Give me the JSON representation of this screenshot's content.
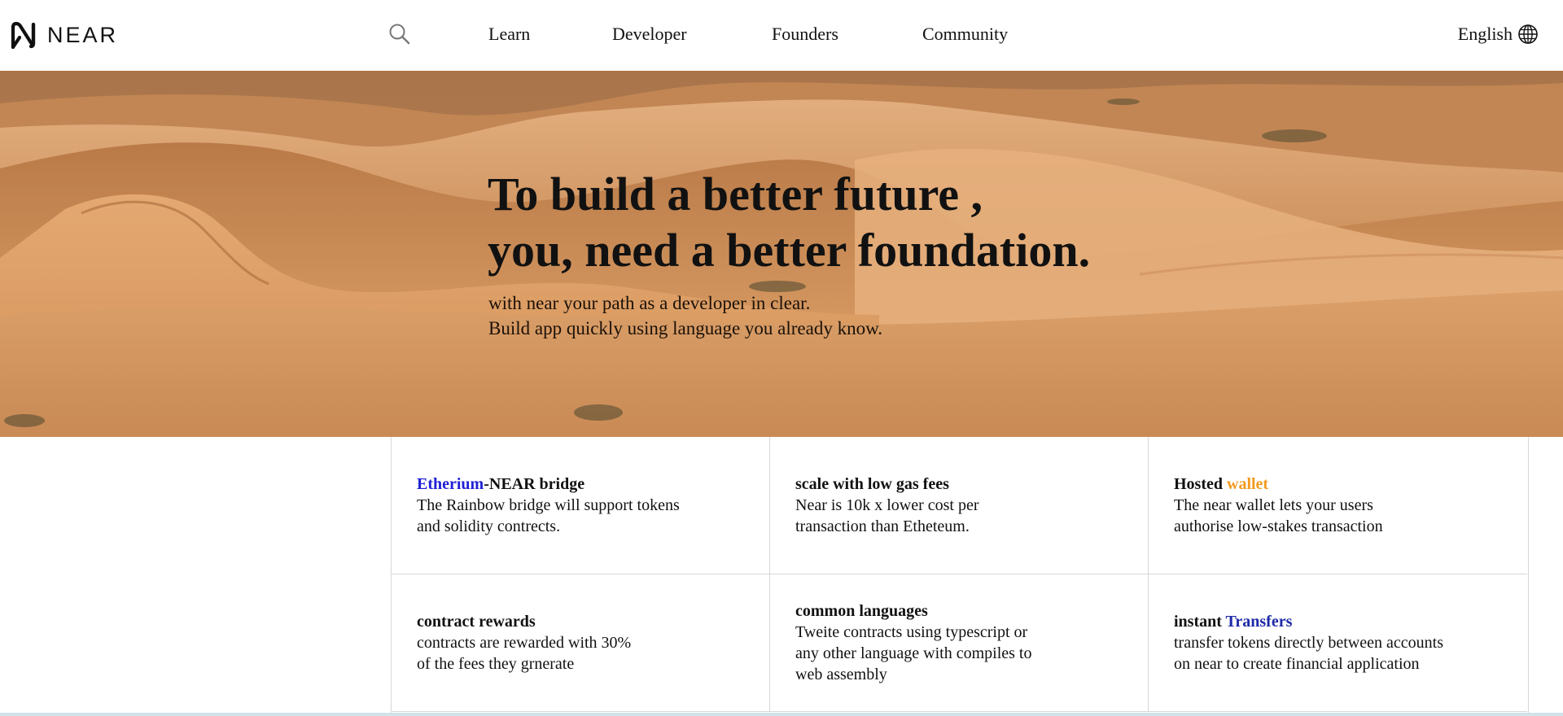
{
  "header": {
    "logo_text": "NEAR",
    "search_icon": "search-icon",
    "nav": [
      {
        "label": "Learn"
      },
      {
        "label": "Developer"
      },
      {
        "label": "Founders"
      },
      {
        "label": "Community"
      }
    ],
    "language": "English",
    "language_icon": "globe-icon"
  },
  "hero": {
    "title_line1": "To build a better future ,",
    "title_line2": "you, need a better foundation.",
    "sub_line1": "with near your path as a developer in clear.",
    "sub_line2": "Build app quickly using language you already know."
  },
  "features": [
    {
      "title_highlight": "Etherium",
      "title_rest": "-NEAR bridge",
      "line1": "The Rainbow bridge will support tokens",
      "line2": "and solidity contrects."
    },
    {
      "title": "scale with low gas fees",
      "line1": "Near is 10k x lower cost per",
      "line2": "transaction than Etheteum."
    },
    {
      "title_prefix": "Hosted ",
      "title_highlight": "wallet",
      "line1": "The near wallet lets your users",
      "line2": "authorise low-stakes transaction"
    },
    {
      "title": "contract rewards",
      "line1": "contracts are rewarded with 30%",
      "line2": "of the fees they grnerate"
    },
    {
      "title": "common languages",
      "line1": "Tweite contracts using typescript or",
      "line2": "any other language with compiles to",
      "line3": "web assembly"
    },
    {
      "title_prefix": "instant ",
      "title_highlight": "Transfers",
      "line1": "transfer tokens directly between accounts",
      "line2": "on near to create financial application"
    }
  ],
  "colors": {
    "highlight_blue": "#1f1fd6",
    "highlight_navy": "#1e2aa8",
    "highlight_orange": "#f29a1e",
    "sand": "#d99e6a"
  }
}
